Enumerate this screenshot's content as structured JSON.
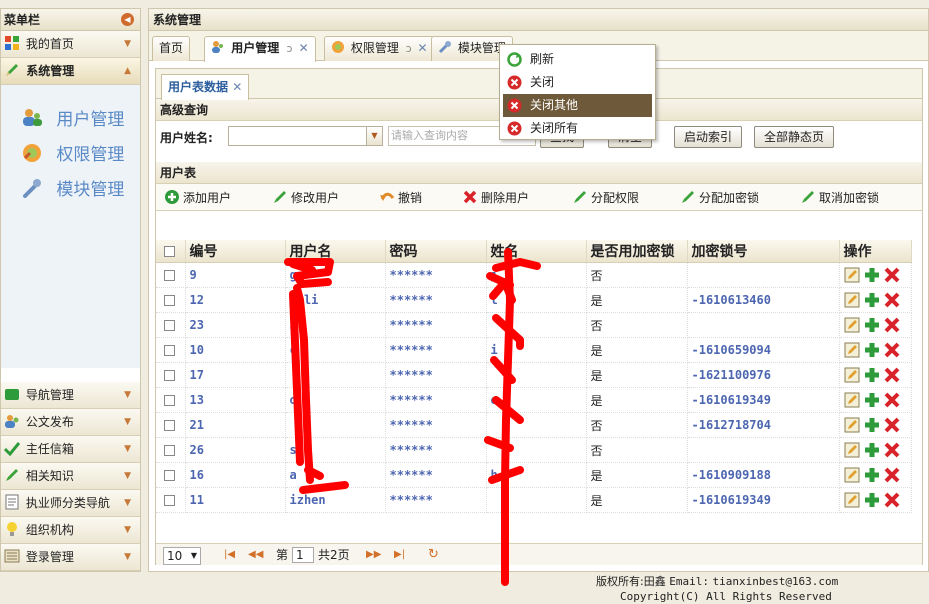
{
  "sidebar": {
    "title": "菜单栏",
    "top_items": [
      {
        "label": "我的首页",
        "icon": "grid-icon"
      },
      {
        "label": "系统管理",
        "icon": "pencil-icon"
      }
    ],
    "sub_items": [
      {
        "label": "用户管理",
        "icon": "users-icon"
      },
      {
        "label": "权限管理",
        "icon": "key-icon"
      },
      {
        "label": "模块管理",
        "icon": "wrench-icon"
      }
    ],
    "bottom_items": [
      {
        "label": "导航管理",
        "icon": "folder-icon"
      },
      {
        "label": "公文发布",
        "icon": "users-icon"
      },
      {
        "label": "主任信箱",
        "icon": "check-icon"
      },
      {
        "label": "相关知识",
        "icon": "pencil-icon"
      },
      {
        "label": "执业师分类导航",
        "icon": "document-icon"
      },
      {
        "label": "组织机构",
        "icon": "bulb-icon"
      },
      {
        "label": "登录管理",
        "icon": "list-icon"
      }
    ]
  },
  "main": {
    "title": "系统管理",
    "tabs": [
      {
        "label": "首页"
      },
      {
        "label": "用户管理"
      },
      {
        "label": "权限管理"
      },
      {
        "label": "模块管理"
      }
    ],
    "inner_tab": "用户表数据",
    "query": {
      "section_title": "高级查询",
      "field_label": "用户姓名:",
      "placeholder": "请输入查询内容",
      "buttons": [
        "查找",
        "清空",
        "启动索引",
        "全部静态页"
      ]
    },
    "table_section_title": "用户表",
    "toolbar": [
      "添加用户",
      "修改用户",
      "撤销",
      "删除用户",
      "分配权限",
      "分配加密锁",
      "取消加密锁"
    ],
    "columns": [
      "编号",
      "用户名",
      "密码",
      "姓名",
      "是否用加密锁",
      "加密锁号",
      "操作"
    ],
    "rows": [
      {
        "id": "9",
        "username": "g",
        "password": "******",
        "name": "j",
        "lock": "否",
        "lock_no": ""
      },
      {
        "id": "12",
        "username": "lili",
        "password": "******",
        "name": "l",
        "lock": "是",
        "lock_no": "-1610613460"
      },
      {
        "id": "23",
        "username": "3",
        "password": "******",
        "name": "",
        "lock": "否",
        "lock_no": ""
      },
      {
        "id": "10",
        "username": "c",
        "password": "******",
        "name": "i",
        "lock": "是",
        "lock_no": "-1610659094"
      },
      {
        "id": "17",
        "username": "",
        "password": "******",
        "name": "",
        "lock": "是",
        "lock_no": "-1621100976"
      },
      {
        "id": "13",
        "username": "o",
        "password": "******",
        "name": "o",
        "lock": "是",
        "lock_no": "-1610619349"
      },
      {
        "id": "21",
        "username": "",
        "password": "******",
        "name": "",
        "lock": "否",
        "lock_no": "-1612718704"
      },
      {
        "id": "26",
        "username": "s",
        "password": "******",
        "name": "",
        "lock": "否",
        "lock_no": ""
      },
      {
        "id": "16",
        "username": "a",
        "password": "******",
        "name": "h",
        "lock": "是",
        "lock_no": "-1610909188"
      },
      {
        "id": "11",
        "username": "izhen",
        "password": "******",
        "name": "",
        "lock": "是",
        "lock_no": "-1610619349"
      }
    ],
    "pager": {
      "page_size": "10",
      "page_prefix": "第",
      "page_value": "1",
      "page_total": "共2页"
    }
  },
  "context_menu": [
    {
      "label": "刷新",
      "icon": "refresh-icon"
    },
    {
      "label": "关闭",
      "icon": "close-circle-icon"
    },
    {
      "label": "关闭其他",
      "icon": "close-circle-icon"
    },
    {
      "label": "关闭所有",
      "icon": "close-circle-icon"
    }
  ],
  "footer": {
    "owner_label": "版权所有:田鑫",
    "email_label": "Email:",
    "email": "tianxinbest@163.com",
    "copyright": "Copyright(C) All Rights Reserved"
  },
  "colors": {
    "accent": "#5a8ac6",
    "menu_highlight": "#6e5a3a",
    "scribble": "#ff0000"
  }
}
